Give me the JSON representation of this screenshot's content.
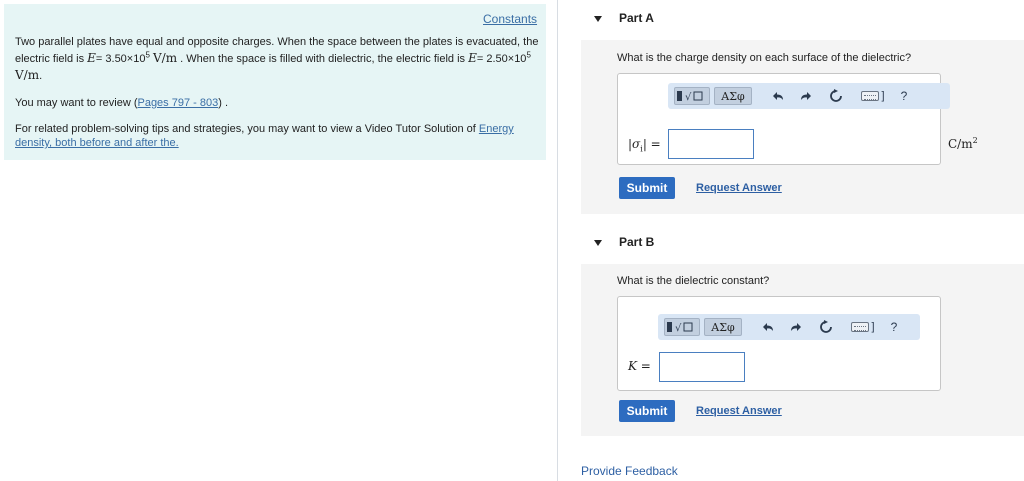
{
  "left_panel": {
    "constants_link": "Constants",
    "problem": {
      "t1": "Two parallel plates have equal and opposite charges. When the space between the plates is evacuated, the electric field is ",
      "e_var": "E",
      "eq": "= ",
      "e1_val": "3.50×10",
      "e1_exp": "5",
      "unit": "V/m",
      "t2": ". When the space is filled with dielectric, the electric field is ",
      "e2_val": "2.50×10",
      "e2_exp": "5",
      "t3": "."
    },
    "review": {
      "prefix": "You may want to review (",
      "link": "Pages 797 - 803",
      "suffix": ") ."
    },
    "tips": {
      "text": "For related problem-solving tips and strategies, you may want to view a Video Tutor Solution of ",
      "link": "Energy density, both before and after the."
    }
  },
  "parts": [
    {
      "title": "Part A",
      "question": "What is the charge density on each surface of the dielectric?",
      "var_symbol": "σ",
      "var_sub": "i",
      "eq": "=",
      "input_value": "",
      "unit_base": "C/m",
      "unit_exp": "2",
      "submit_label": "Submit",
      "request_label": "Request Answer"
    },
    {
      "title": "Part B",
      "question": "What is the dielectric constant?",
      "var_symbol": "K",
      "eq": "=",
      "input_value": "",
      "submit_label": "Submit",
      "request_label": "Request Answer"
    }
  ],
  "toolbar": {
    "greek_label": "ΑΣφ",
    "help_label": "?",
    "icons": [
      "template-icon",
      "undo-icon",
      "redo-icon",
      "reset-icon",
      "keyboard-icon",
      "help-icon"
    ]
  },
  "footer": {
    "feedback_label": "Provide Feedback"
  },
  "colors": {
    "panel_bg": "#e6f5f5",
    "link": "#3a6ea5",
    "submit_bg": "#2d6cc0",
    "toolbar_bg": "#d9e6f5",
    "part_body_bg": "#f4f4f4"
  }
}
